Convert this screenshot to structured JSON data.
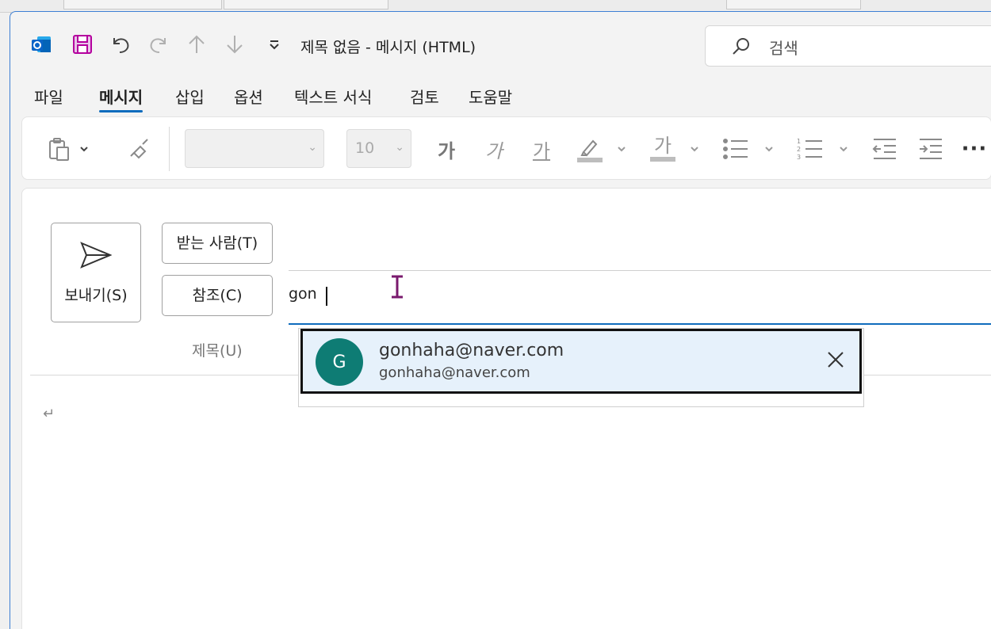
{
  "window": {
    "title": "제목 없음  -  메시지 (HTML)"
  },
  "quick_access": {
    "icons": [
      "outlook-icon",
      "save-icon",
      "undo-icon",
      "redo-icon",
      "up-arrow-icon",
      "down-arrow-icon",
      "customize-dropdown-icon"
    ]
  },
  "search": {
    "placeholder": "검색"
  },
  "ribbon": {
    "tabs": [
      {
        "label": "파일",
        "active": false
      },
      {
        "label": "메시지",
        "active": true
      },
      {
        "label": "삽입",
        "active": false
      },
      {
        "label": "옵션",
        "active": false
      },
      {
        "label": "텍스트 서식",
        "active": false
      },
      {
        "label": "검토",
        "active": false
      },
      {
        "label": "도움말",
        "active": false
      }
    ]
  },
  "toolbar": {
    "font_name": "",
    "font_size": "10",
    "bold_glyph": "가",
    "italic_glyph": "가",
    "underline_glyph": "가",
    "font_color_glyph": "가",
    "more": "···"
  },
  "compose": {
    "send_label": "보내기(S)",
    "to_label": "받는 사람(T)",
    "cc_label": "참조(C)",
    "cc_value": "gon",
    "subject_label": "제목(U)",
    "body_mark": "↵"
  },
  "autocomplete": {
    "avatar_initial": "G",
    "avatar_color": "#0e7c74",
    "display_name": "gonhaha@naver.com",
    "email": "gonhaha@naver.com"
  },
  "colors": {
    "accent": "#0f6cbd",
    "outlook_blue": "#0a64c8",
    "save_purple": "#b4009e"
  }
}
